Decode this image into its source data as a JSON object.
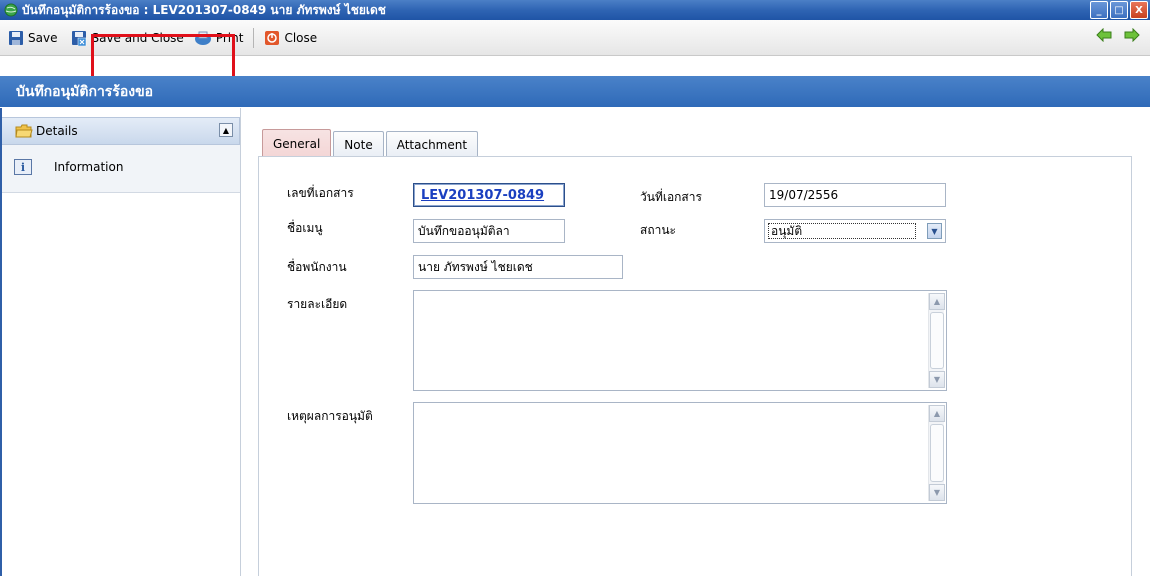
{
  "window": {
    "title": "บันทึกอนุมัติการร้องขอ : LEV201307-0849 นาย ภัทรพงษ์ ไชยเดช",
    "controls": {
      "minimize": "_",
      "maximize": "□",
      "close": "X"
    }
  },
  "toolbar": {
    "save_label": "Save",
    "save_close_label": "Save and Close",
    "print_label": "Print",
    "close_label": "Close",
    "back_icon": "arrow-left-icon",
    "forward_icon": "arrow-right-icon"
  },
  "header": {
    "title": "บันทึกอนุมัติการร้องขอ"
  },
  "sidebar": {
    "section_label": "Details",
    "collapse_glyph": "▲",
    "items": [
      {
        "label": "Information",
        "icon": "information-icon",
        "icon_glyph": "i"
      }
    ]
  },
  "tabs": [
    {
      "label": "General",
      "active": true
    },
    {
      "label": "Note",
      "active": false
    },
    {
      "label": "Attachment",
      "active": false
    }
  ],
  "form": {
    "doc_no_label": "เลขที่เอกสาร",
    "doc_no_value": "LEV201307-0849",
    "doc_date_label": "วันที่เอกสาร",
    "doc_date_value": "19/07/2556",
    "menu_name_label": "ชื่อเมนู",
    "menu_name_value": "บันทึกขออนุมัติลา",
    "status_label": "สถานะ",
    "status_value": "อนุมัติ",
    "employee_label": "ชื่อพนักงาน",
    "employee_value": "นาย ภัทรพงษ์ ไชยเดช",
    "detail_label": "รายละเอียด",
    "detail_value": "",
    "reason_label": "เหตุผลการอนุมัติ",
    "reason_value": ""
  },
  "colors": {
    "title_bar": "#2f64b3",
    "header_band": "#3a74c0",
    "highlight": "#e0101a",
    "link": "#1a3fc0"
  }
}
